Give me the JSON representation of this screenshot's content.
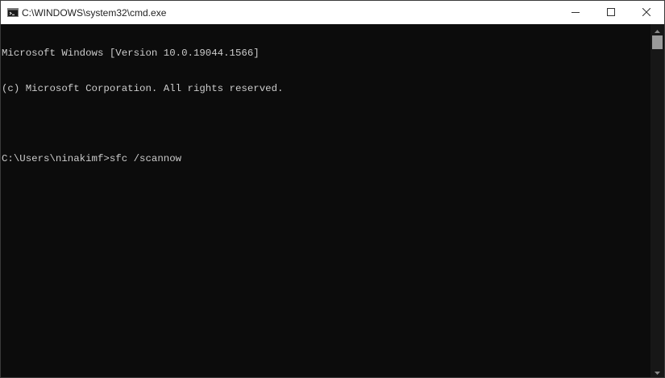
{
  "window": {
    "title": "C:\\WINDOWS\\system32\\cmd.exe",
    "app_icon": "cmd-icon",
    "controls": {
      "minimize_icon": "minimize-icon",
      "maximize_icon": "maximize-icon",
      "close_icon": "close-icon"
    }
  },
  "console": {
    "lines": [
      "Microsoft Windows [Version 10.0.19044.1566]",
      "(c) Microsoft Corporation. All rights reserved.",
      "",
      "C:\\Users\\ninakimf>sfc /scannow"
    ]
  },
  "colors": {
    "console_bg": "#0c0c0c",
    "console_text": "#cccccc",
    "titlebar_bg": "#ffffff"
  }
}
